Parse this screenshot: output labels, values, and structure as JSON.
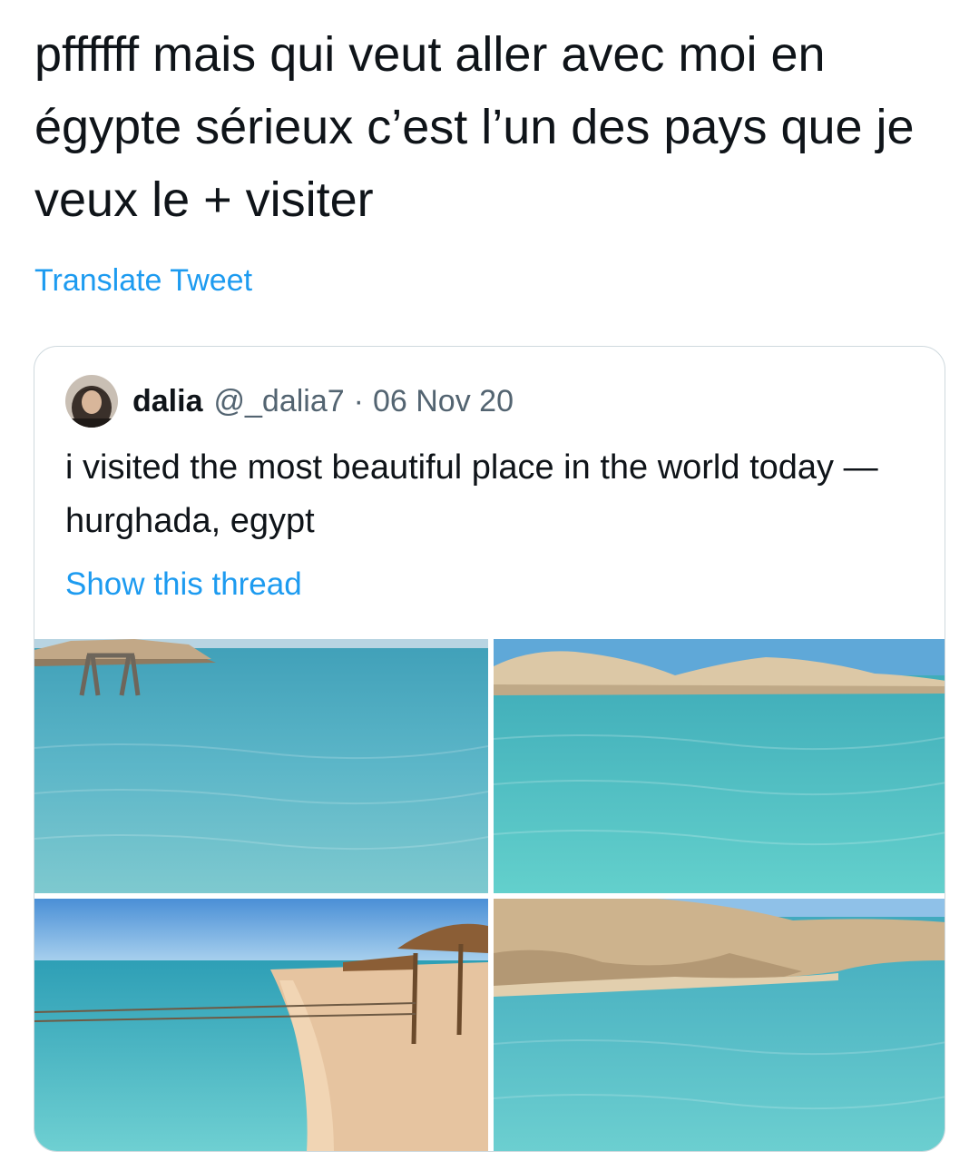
{
  "tweet": {
    "text": "pffffff mais qui veut aller avec moi en égypte sérieux c’est l’un des pays que je veux le + visiter",
    "translate_label": "Translate Tweet"
  },
  "quoted": {
    "name": "dalia",
    "handle": "@_dalia7",
    "separator": "·",
    "date": "06 Nov 20",
    "text": "i visited the most beautiful place in the world today — hurghada, egypt",
    "show_thread_label": "Show this thread"
  },
  "colors": {
    "link": "#1d9bf0",
    "text": "#0f1419",
    "secondary": "#536471",
    "border": "#cfd9de"
  },
  "icons": {
    "avatar": "user-avatar-photo"
  }
}
